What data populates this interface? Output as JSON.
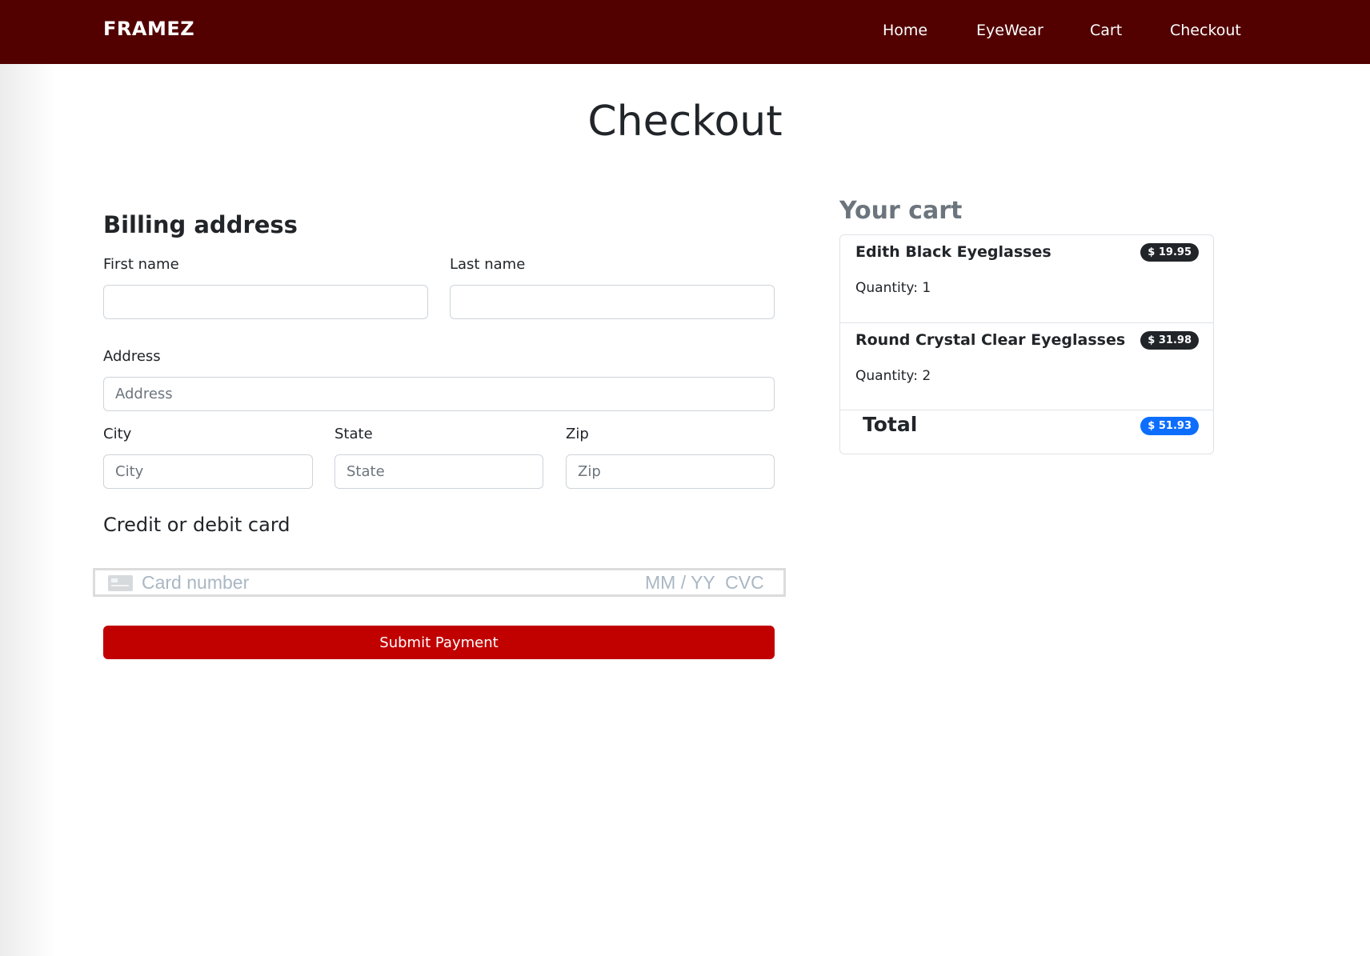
{
  "nav": {
    "brand": "FRAMEZ",
    "links": [
      "Home",
      "EyeWear",
      "Cart",
      "Checkout"
    ]
  },
  "page": {
    "title": "Checkout"
  },
  "billing": {
    "heading": "Billing address",
    "first_name_label": "First name",
    "first_name_value": "",
    "last_name_label": "Last name",
    "last_name_value": "",
    "address_label": "Address",
    "address_placeholder": "Address",
    "city_label": "City",
    "city_placeholder": "City",
    "state_label": "State",
    "state_placeholder": "State",
    "zip_label": "Zip",
    "zip_placeholder": "Zip"
  },
  "card": {
    "heading": "Credit or debit card",
    "number_placeholder": "Card number",
    "expiry_cvc_placeholder": "MM / YY  CVC",
    "icon": "credit-card-icon"
  },
  "submit_label": "Submit Payment",
  "cart": {
    "heading": "Your cart",
    "items": [
      {
        "name": "Edith Black Eyeglasses",
        "quantity_text": "Quantity: 1",
        "price": "$ 19.95"
      },
      {
        "name": "Round Crystal Clear Eyeglasses",
        "quantity_text": "Quantity: 2",
        "price": "$ 31.98"
      }
    ],
    "total_label": "Total",
    "total_price": "$ 51.93"
  },
  "colors": {
    "navbar": "#520000",
    "submit_button": "#c10000",
    "price_badge": "#212529",
    "total_badge": "#0d6efd"
  }
}
